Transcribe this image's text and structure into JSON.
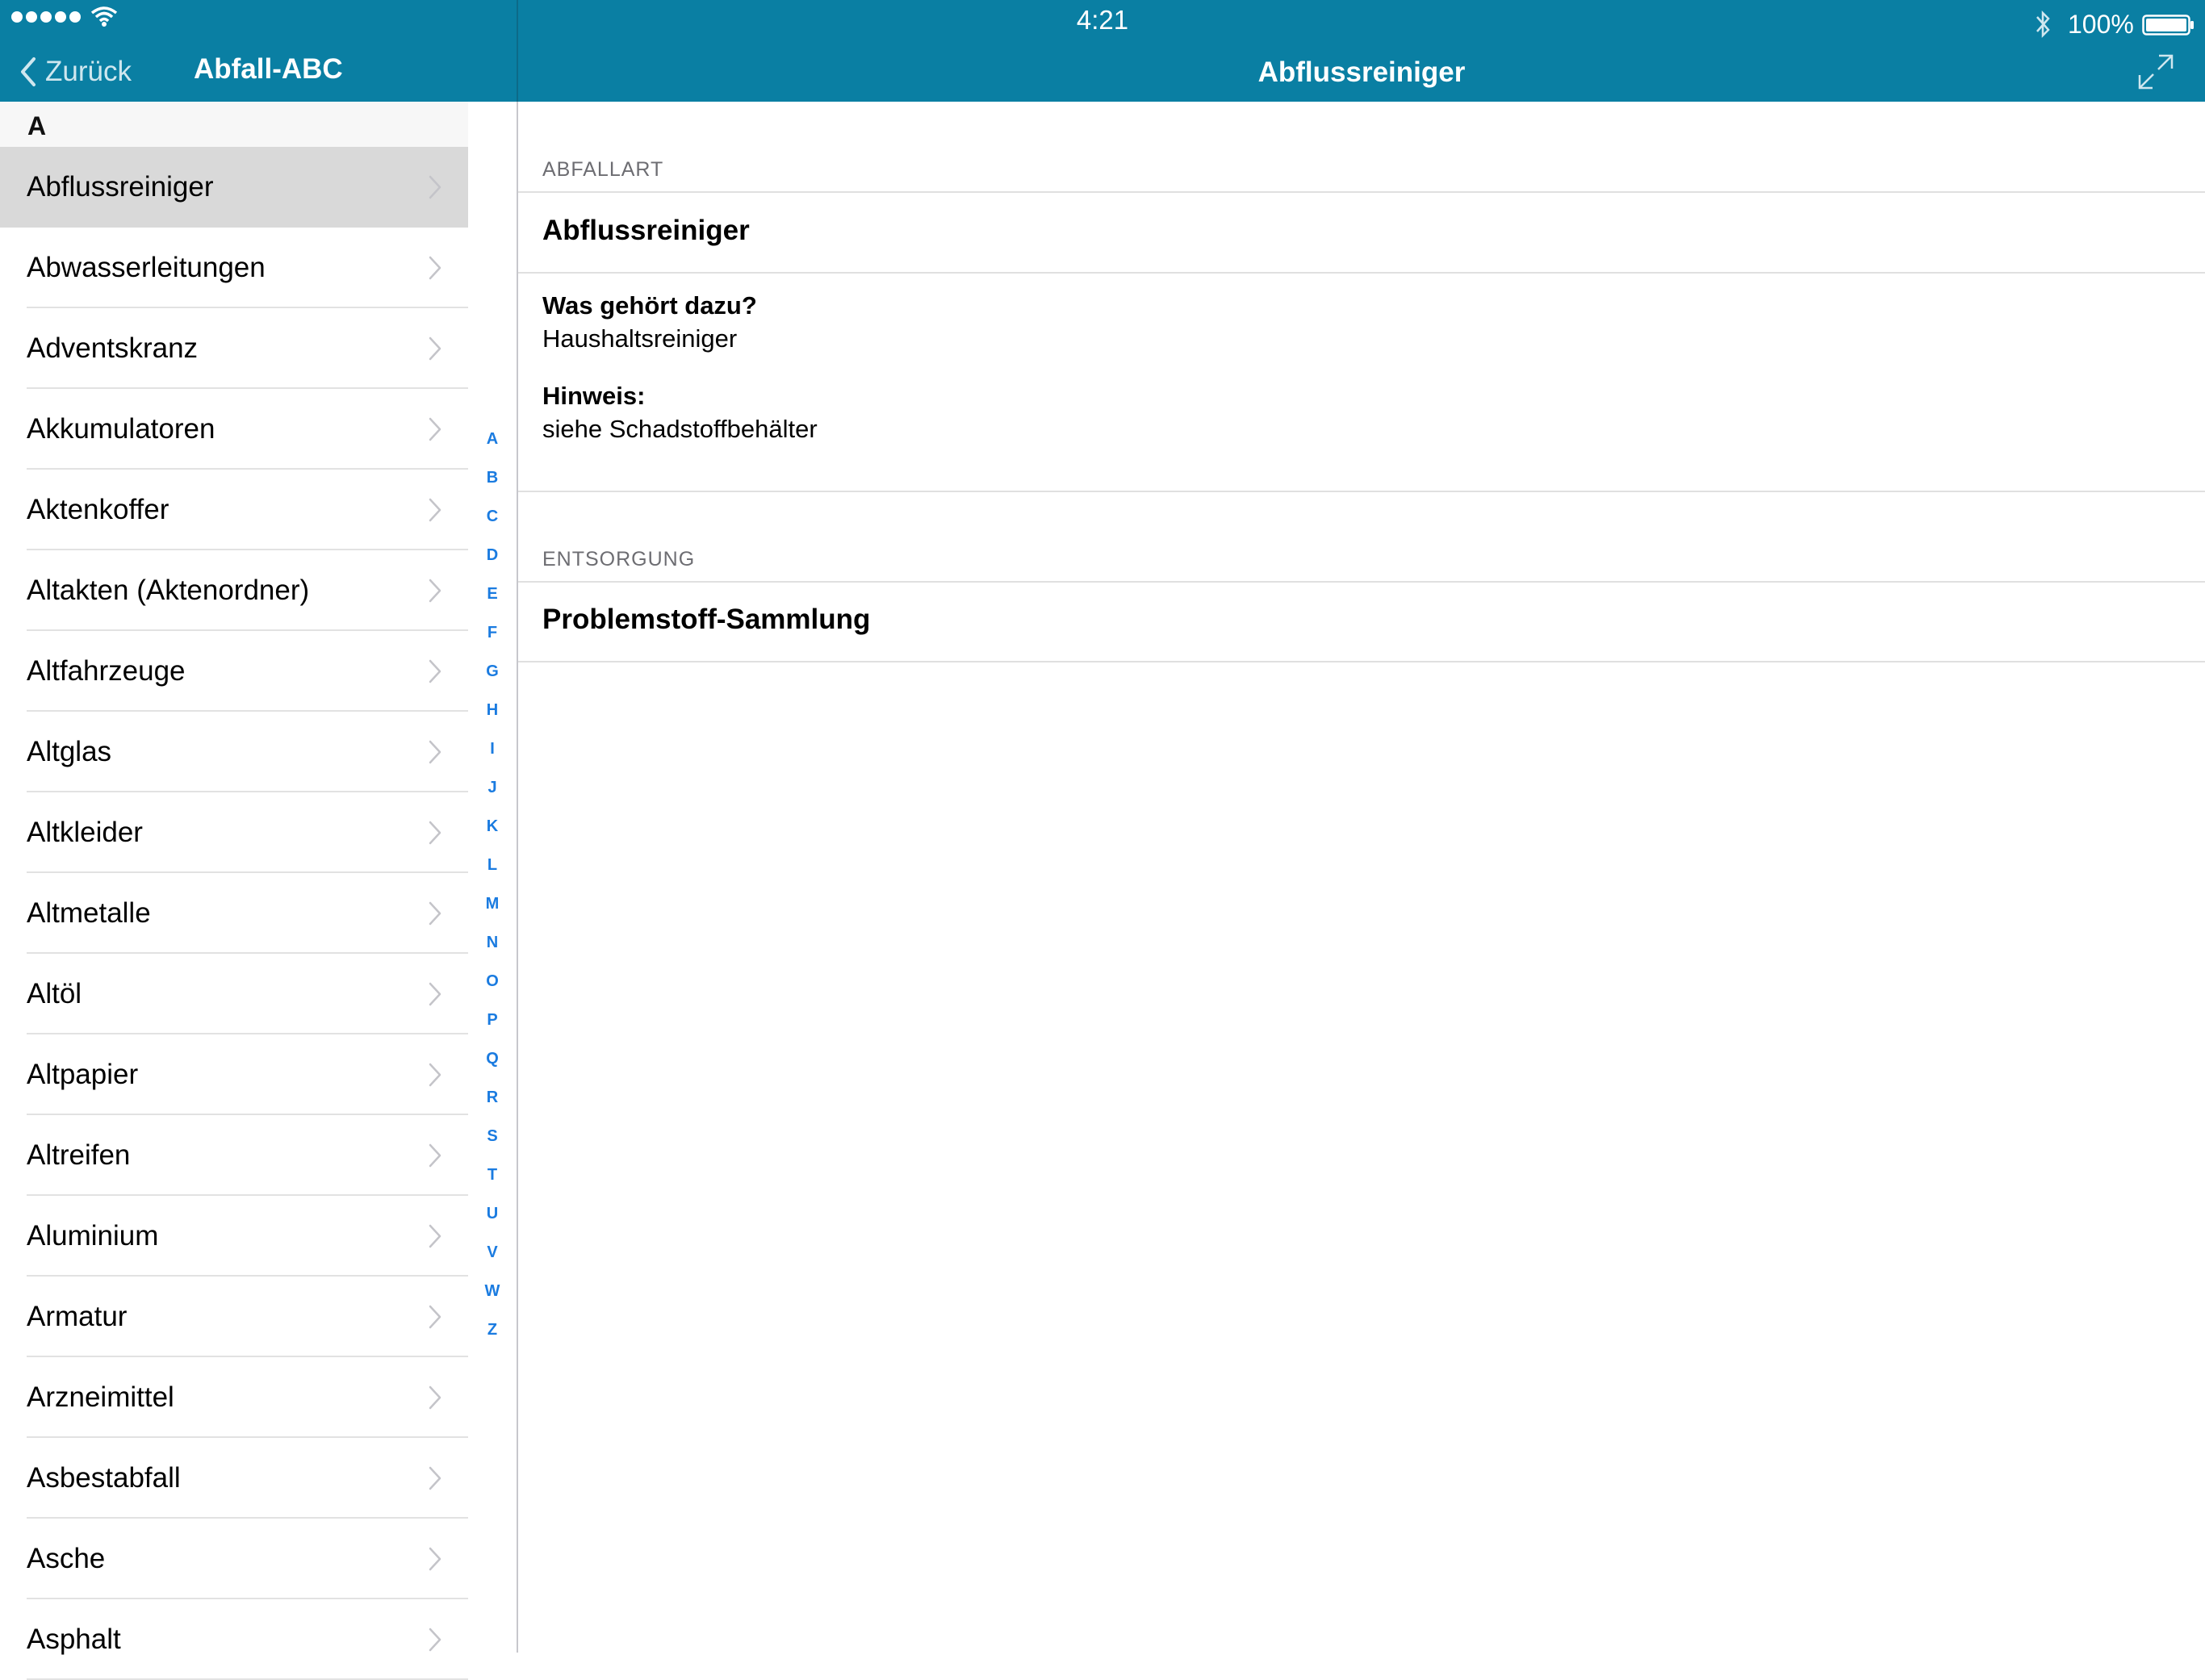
{
  "status_bar": {
    "time": "4:21",
    "battery": "100%"
  },
  "nav": {
    "back_label": "Zurück",
    "master_title": "Abfall-ABC",
    "detail_title": "Abflussreiniger"
  },
  "master": {
    "section": "A",
    "selected_index": 0,
    "items": [
      {
        "label": "Abflussreiniger"
      },
      {
        "label": "Abwasserleitungen"
      },
      {
        "label": "Adventskranz"
      },
      {
        "label": "Akkumulatoren"
      },
      {
        "label": "Aktenkoffer"
      },
      {
        "label": "Altakten (Aktenordner)"
      },
      {
        "label": "Altfahrzeuge"
      },
      {
        "label": "Altglas"
      },
      {
        "label": "Altkleider"
      },
      {
        "label": "Altmetalle"
      },
      {
        "label": "Altöl"
      },
      {
        "label": "Altpapier"
      },
      {
        "label": "Altreifen"
      },
      {
        "label": "Aluminium"
      },
      {
        "label": "Armatur"
      },
      {
        "label": "Arzneimittel"
      },
      {
        "label": "Asbestabfall"
      },
      {
        "label": "Asche"
      },
      {
        "label": "Asphalt"
      }
    ],
    "index_letters": [
      "A",
      "B",
      "C",
      "D",
      "E",
      "F",
      "G",
      "H",
      "I",
      "J",
      "K",
      "L",
      "M",
      "N",
      "O",
      "P",
      "Q",
      "R",
      "S",
      "T",
      "U",
      "V",
      "W",
      "Z"
    ]
  },
  "detail": {
    "abfallart_header": "ABFALLART",
    "abfallart_value": "Abflussreiniger",
    "question_title": "Was gehört dazu?",
    "question_text": "Haushaltsreiniger",
    "hint_title": "Hinweis:",
    "hint_text": "siehe Schadstoffbehälter",
    "entsorgung_header": "ENTSORGUNG",
    "entsorgung_value": "Problemstoff-Sammlung"
  },
  "colors": {
    "bar": "#0a7fa3",
    "index_accent": "#1a7be0",
    "selected_row": "#d9d9d9"
  }
}
